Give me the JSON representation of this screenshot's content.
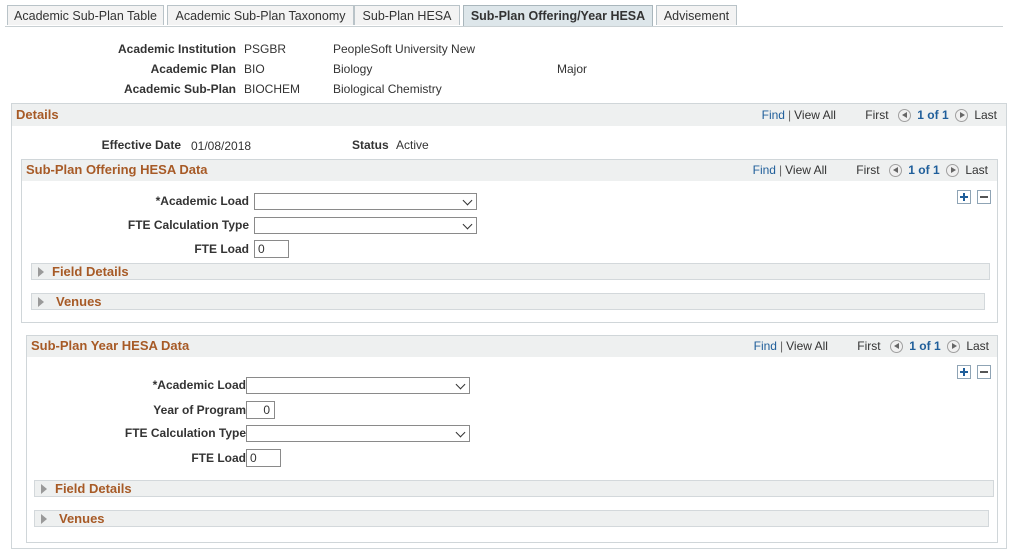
{
  "tabs": [
    {
      "label": "Academic Sub-Plan Table"
    },
    {
      "label": "Academic Sub-Plan Taxonomy"
    },
    {
      "label": "Sub-Plan HESA"
    },
    {
      "label": "Sub-Plan Offering/Year HESA"
    },
    {
      "label": "Advisement"
    }
  ],
  "active_tab": "Sub-Plan Offering/Year HESA",
  "header": {
    "institution_label": "Academic Institution",
    "institution_code": "PSGBR",
    "institution_name": "PeopleSoft University New",
    "plan_label": "Academic Plan",
    "plan_code": "BIO",
    "plan_name": "Biology",
    "plan_type": "Major",
    "subplan_label": "Academic Sub-Plan",
    "subplan_code": "BIOCHEM",
    "subplan_name": "Biological Chemistry"
  },
  "details": {
    "title": "Details",
    "find": "Find",
    "view_all": "View All",
    "first": "First",
    "count": "1 of 1",
    "last": "Last",
    "effective_date_label": "Effective Date",
    "effective_date": "01/08/2018",
    "status_label": "Status",
    "status": "Active"
  },
  "offering": {
    "title": "Sub-Plan Offering HESA Data",
    "find": "Find",
    "view_all": "View All",
    "first": "First",
    "count": "1 of 1",
    "last": "Last",
    "academic_load_label": "*Academic Load",
    "academic_load_value": "",
    "fte_calc_label": "FTE Calculation Type",
    "fte_calc_value": "",
    "fte_load_label": "FTE Load",
    "fte_load_value": "0",
    "field_details": "Field Details",
    "venues": "Venues"
  },
  "year": {
    "title": "Sub-Plan Year HESA Data",
    "find": "Find",
    "view_all": "View All",
    "first": "First",
    "count": "1 of 1",
    "last": "Last",
    "academic_load_label": "*Academic Load",
    "academic_load_value": "",
    "year_of_program_label": "Year of Program",
    "year_of_program_value": "0",
    "fte_calc_label": "FTE Calculation Type",
    "fte_calc_value": "",
    "fte_load_label": "FTE Load",
    "fte_load_value": "0",
    "field_details": "Field Details",
    "venues": "Venues"
  },
  "icons": {
    "prev": "chevron-left-circle-icon",
    "next": "chevron-right-circle-icon",
    "add_row": "plus-icon",
    "delete_row": "minus-icon",
    "expand": "triangle-right-icon",
    "dropdown": "chevron-down-icon"
  },
  "colors": {
    "section_title": "#a75a26",
    "link": "#1f5e9a",
    "header_bg": "#eef0f0",
    "active_tab_bg": "#dde6ea"
  }
}
